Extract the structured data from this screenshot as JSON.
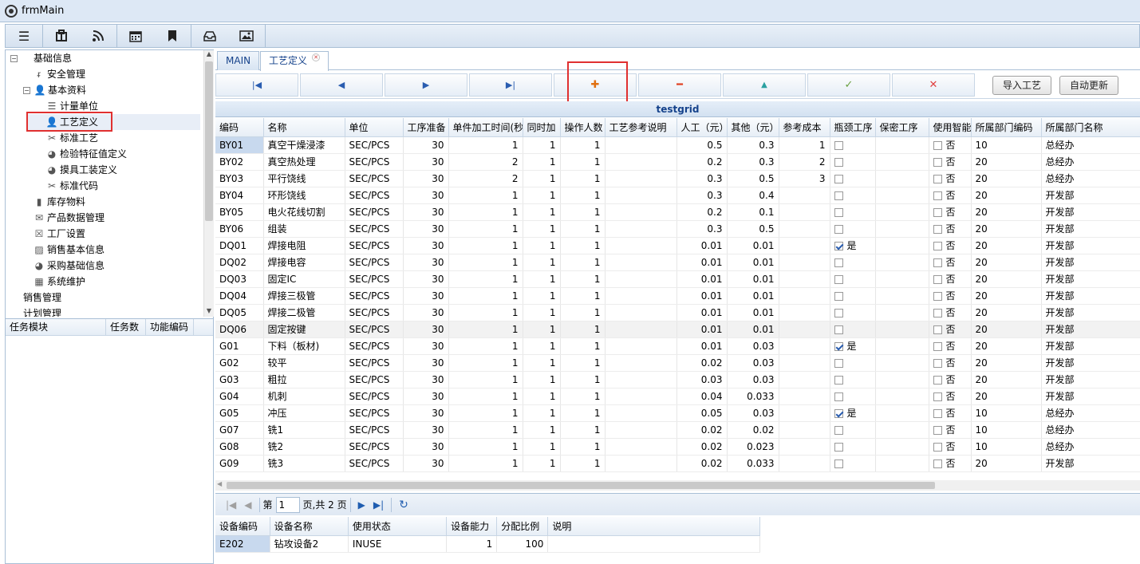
{
  "window": {
    "title": "frmMain"
  },
  "toolbar": {
    "buttons": [
      "menu-icon",
      "briefcase-icon",
      "rss-icon",
      "calendar-icon",
      "bookmark-icon",
      "inbox-icon",
      "image-icon"
    ]
  },
  "tree": {
    "items": [
      {
        "label": "基础信息",
        "icon": "folder"
      },
      {
        "label": "安全管理",
        "icon": "rss-icon"
      },
      {
        "label": "基本资料",
        "icon": "user-icon"
      },
      {
        "label": "计量单位",
        "icon": "list-icon"
      },
      {
        "label": "工艺定义",
        "icon": "user-icon"
      },
      {
        "label": "标准工艺",
        "icon": "scissors-icon"
      },
      {
        "label": "检验特征值定义",
        "icon": "pie-icon"
      },
      {
        "label": "摸具工装定义",
        "icon": "pie-icon"
      },
      {
        "label": "标准代码",
        "icon": "scissors-icon"
      },
      {
        "label": "库存物料",
        "icon": "bookmark-icon"
      },
      {
        "label": "产品数据管理",
        "icon": "mail-icon"
      },
      {
        "label": "工厂设置",
        "icon": "x-box-icon"
      },
      {
        "label": "销售基本信息",
        "icon": "image-icon"
      },
      {
        "label": "采购基础信息",
        "icon": "pie-icon"
      },
      {
        "label": "系统维护",
        "icon": "building-icon"
      },
      {
        "label": "销售管理",
        "icon": ""
      },
      {
        "label": "计划管理",
        "icon": ""
      }
    ]
  },
  "task_table": {
    "headers": [
      "任务模块",
      "任务数",
      "功能编码"
    ]
  },
  "tabs": [
    {
      "label": "MAIN"
    },
    {
      "label": "工艺定义"
    }
  ],
  "nav": {
    "first": "|◀",
    "prev": "◀",
    "next": "▶",
    "last": "▶|",
    "add": "✚",
    "remove": "━",
    "up": "▲",
    "confirm": "✓",
    "cancel": "✕",
    "import_label": "导入工艺",
    "auto_update_label": "自动更新"
  },
  "grid": {
    "caption": "testgrid",
    "headers": [
      "编码",
      "名称",
      "单位",
      "工序准备",
      "单件加工时间(秒)",
      "同时加",
      "操作人数",
      "工艺参考说明",
      "人工（元）",
      "其他（元）",
      "参考成本",
      "瓶颈工序",
      "保密工序",
      "使用智能",
      "所属部门编码",
      "所属部门名称"
    ],
    "rows": [
      {
        "code": "BY01",
        "name": "真空干燥浸漆",
        "unit": "SEC/PCS",
        "prep": "30",
        "time": "1",
        "simul": "1",
        "ops": "1",
        "note": "",
        "labor": "0.5",
        "other": "0.3",
        "cost": "1",
        "bottleneck": false,
        "bn_text": "",
        "secret": "",
        "smart": "否",
        "dept_code": "10",
        "dept_name": "总经办"
      },
      {
        "code": "BY02",
        "name": "真空热处理",
        "unit": "SEC/PCS",
        "prep": "30",
        "time": "2",
        "simul": "1",
        "ops": "1",
        "note": "",
        "labor": "0.2",
        "other": "0.3",
        "cost": "2",
        "bottleneck": false,
        "bn_text": "",
        "secret": "",
        "smart": "否",
        "dept_code": "20",
        "dept_name": "总经办"
      },
      {
        "code": "BY03",
        "name": "平行饶线",
        "unit": "SEC/PCS",
        "prep": "30",
        "time": "2",
        "simul": "1",
        "ops": "1",
        "note": "",
        "labor": "0.3",
        "other": "0.5",
        "cost": "3",
        "bottleneck": false,
        "bn_text": "",
        "secret": "",
        "smart": "否",
        "dept_code": "20",
        "dept_name": "总经办"
      },
      {
        "code": "BY04",
        "name": "环形饶线",
        "unit": "SEC/PCS",
        "prep": "30",
        "time": "1",
        "simul": "1",
        "ops": "1",
        "note": "",
        "labor": "0.3",
        "other": "0.4",
        "cost": "",
        "bottleneck": false,
        "bn_text": "",
        "secret": "",
        "smart": "否",
        "dept_code": "20",
        "dept_name": "开发部"
      },
      {
        "code": "BY05",
        "name": "电火花线切割",
        "unit": "SEC/PCS",
        "prep": "30",
        "time": "1",
        "simul": "1",
        "ops": "1",
        "note": "",
        "labor": "0.2",
        "other": "0.1",
        "cost": "",
        "bottleneck": false,
        "bn_text": "",
        "secret": "",
        "smart": "否",
        "dept_code": "20",
        "dept_name": "开发部"
      },
      {
        "code": "BY06",
        "name": "组装",
        "unit": "SEC/PCS",
        "prep": "30",
        "time": "1",
        "simul": "1",
        "ops": "1",
        "note": "",
        "labor": "0.3",
        "other": "0.5",
        "cost": "",
        "bottleneck": false,
        "bn_text": "",
        "secret": "",
        "smart": "否",
        "dept_code": "20",
        "dept_name": "开发部"
      },
      {
        "code": "DQ01",
        "name": "焊接电阻",
        "unit": "SEC/PCS",
        "prep": "30",
        "time": "1",
        "simul": "1",
        "ops": "1",
        "note": "",
        "labor": "0.01",
        "other": "0.01",
        "cost": "",
        "bottleneck": true,
        "bn_text": "是",
        "secret": "",
        "smart": "否",
        "dept_code": "20",
        "dept_name": "开发部"
      },
      {
        "code": "DQ02",
        "name": "焊接电容",
        "unit": "SEC/PCS",
        "prep": "30",
        "time": "1",
        "simul": "1",
        "ops": "1",
        "note": "",
        "labor": "0.01",
        "other": "0.01",
        "cost": "",
        "bottleneck": false,
        "bn_text": "",
        "secret": "",
        "smart": "否",
        "dept_code": "20",
        "dept_name": "开发部"
      },
      {
        "code": "DQ03",
        "name": "固定IC",
        "unit": "SEC/PCS",
        "prep": "30",
        "time": "1",
        "simul": "1",
        "ops": "1",
        "note": "",
        "labor": "0.01",
        "other": "0.01",
        "cost": "",
        "bottleneck": false,
        "bn_text": "",
        "secret": "",
        "smart": "否",
        "dept_code": "20",
        "dept_name": "开发部"
      },
      {
        "code": "DQ04",
        "name": "焊接三极管",
        "unit": "SEC/PCS",
        "prep": "30",
        "time": "1",
        "simul": "1",
        "ops": "1",
        "note": "",
        "labor": "0.01",
        "other": "0.01",
        "cost": "",
        "bottleneck": false,
        "bn_text": "",
        "secret": "",
        "smart": "否",
        "dept_code": "20",
        "dept_name": "开发部"
      },
      {
        "code": "DQ05",
        "name": "焊接二极管",
        "unit": "SEC/PCS",
        "prep": "30",
        "time": "1",
        "simul": "1",
        "ops": "1",
        "note": "",
        "labor": "0.01",
        "other": "0.01",
        "cost": "",
        "bottleneck": false,
        "bn_text": "",
        "secret": "",
        "smart": "否",
        "dept_code": "20",
        "dept_name": "开发部"
      },
      {
        "code": "DQ06",
        "name": "固定按键",
        "unit": "SEC/PCS",
        "prep": "30",
        "time": "1",
        "simul": "1",
        "ops": "1",
        "note": "",
        "labor": "0.01",
        "other": "0.01",
        "cost": "",
        "bottleneck": false,
        "bn_text": "",
        "secret": "",
        "smart": "否",
        "dept_code": "20",
        "dept_name": "开发部"
      },
      {
        "code": "G01",
        "name": "下料（板材)",
        "unit": "SEC/PCS",
        "prep": "30",
        "time": "1",
        "simul": "1",
        "ops": "1",
        "note": "",
        "labor": "0.01",
        "other": "0.03",
        "cost": "",
        "bottleneck": true,
        "bn_text": "是",
        "secret": "",
        "smart": "否",
        "dept_code": "20",
        "dept_name": "开发部"
      },
      {
        "code": "G02",
        "name": "较平",
        "unit": "SEC/PCS",
        "prep": "30",
        "time": "1",
        "simul": "1",
        "ops": "1",
        "note": "",
        "labor": "0.02",
        "other": "0.03",
        "cost": "",
        "bottleneck": false,
        "bn_text": "",
        "secret": "",
        "smart": "否",
        "dept_code": "20",
        "dept_name": "开发部"
      },
      {
        "code": "G03",
        "name": "粗拉",
        "unit": "SEC/PCS",
        "prep": "30",
        "time": "1",
        "simul": "1",
        "ops": "1",
        "note": "",
        "labor": "0.03",
        "other": "0.03",
        "cost": "",
        "bottleneck": false,
        "bn_text": "",
        "secret": "",
        "smart": "否",
        "dept_code": "20",
        "dept_name": "开发部"
      },
      {
        "code": "G04",
        "name": "机刺",
        "unit": "SEC/PCS",
        "prep": "30",
        "time": "1",
        "simul": "1",
        "ops": "1",
        "note": "",
        "labor": "0.04",
        "other": "0.033",
        "cost": "",
        "bottleneck": false,
        "bn_text": "",
        "secret": "",
        "smart": "否",
        "dept_code": "20",
        "dept_name": "开发部"
      },
      {
        "code": "G05",
        "name": "冲压",
        "unit": "SEC/PCS",
        "prep": "30",
        "time": "1",
        "simul": "1",
        "ops": "1",
        "note": "",
        "labor": "0.05",
        "other": "0.03",
        "cost": "",
        "bottleneck": true,
        "bn_text": "是",
        "secret": "",
        "smart": "否",
        "dept_code": "10",
        "dept_name": "总经办"
      },
      {
        "code": "G07",
        "name": "铣1",
        "unit": "SEC/PCS",
        "prep": "30",
        "time": "1",
        "simul": "1",
        "ops": "1",
        "note": "",
        "labor": "0.02",
        "other": "0.02",
        "cost": "",
        "bottleneck": false,
        "bn_text": "",
        "secret": "",
        "smart": "否",
        "dept_code": "10",
        "dept_name": "总经办"
      },
      {
        "code": "G08",
        "name": "铣2",
        "unit": "SEC/PCS",
        "prep": "30",
        "time": "1",
        "simul": "1",
        "ops": "1",
        "note": "",
        "labor": "0.02",
        "other": "0.023",
        "cost": "",
        "bottleneck": false,
        "bn_text": "",
        "secret": "",
        "smart": "否",
        "dept_code": "10",
        "dept_name": "总经办"
      },
      {
        "code": "G09",
        "name": "铣3",
        "unit": "SEC/PCS",
        "prep": "30",
        "time": "1",
        "simul": "1",
        "ops": "1",
        "note": "",
        "labor": "0.02",
        "other": "0.033",
        "cost": "",
        "bottleneck": false,
        "bn_text": "",
        "secret": "",
        "smart": "否",
        "dept_code": "20",
        "dept_name": "开发部"
      }
    ]
  },
  "pager": {
    "page_prefix": "第",
    "page_value": "1",
    "page_suffix": "页,共 2 页"
  },
  "equipment": {
    "headers": [
      "设备编码",
      "设备名称",
      "使用状态",
      "设备能力",
      "分配比例",
      "说明"
    ],
    "rows": [
      {
        "code": "E202",
        "name": "钻攻设备2",
        "status": "INUSE",
        "capacity": "1",
        "ratio": "100",
        "note": ""
      }
    ]
  }
}
